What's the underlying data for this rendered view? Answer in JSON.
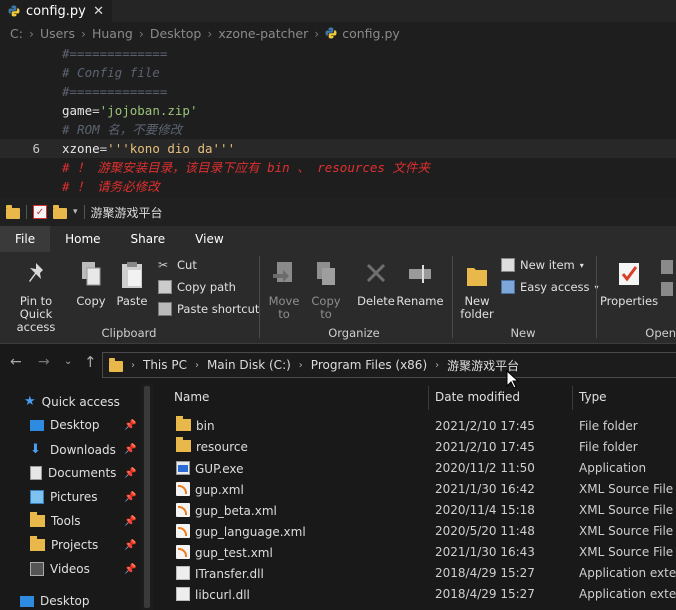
{
  "editor": {
    "tab_label": "config.py",
    "tab_close": "✕",
    "breadcrumb": [
      "C:",
      "Users",
      "Huang",
      "Desktop",
      "xzone-patcher",
      "config.py"
    ],
    "current_line_number": "6",
    "lines": {
      "l1": "#=============",
      "l2": "# Config file",
      "l3": "#=============",
      "l4_var": "game",
      "l4_op": "=",
      "l4_str": "'jojoban.zip'",
      "l5": "# ROM 名，不要修改",
      "l6_var": "xzone",
      "l6_op": "=",
      "l6_str": "'''kono dio da'''",
      "l7": "# ！ 游聚安装目录，该目录下应有 bin 、 resources 文件夹",
      "l8": "# ！ 请务必修改"
    }
  },
  "explorer": {
    "title": "游聚游戏平台",
    "menu": [
      "File",
      "Home",
      "Share",
      "View"
    ],
    "ribbon": {
      "clipboard": {
        "label": "Clipboard",
        "pin": "Pin to Quick access",
        "copy": "Copy",
        "paste": "Paste",
        "cut": "Cut",
        "copy_path": "Copy path",
        "paste_shortcut": "Paste shortcut"
      },
      "organize": {
        "label": "Organize",
        "move_to": "Move to",
        "copy_to": "Copy to",
        "delete": "Delete",
        "rename": "Rename"
      },
      "new": {
        "label": "New",
        "new_folder": "New folder",
        "new_item": "New item",
        "easy_access": "Easy access"
      },
      "open": {
        "label": "Open",
        "properties": "Properties"
      }
    },
    "address": {
      "segments": [
        "This PC",
        "Main Disk (C:)",
        "Program Files (x86)",
        "游聚游戏平台"
      ]
    },
    "nav_pane": {
      "quick_access": "Quick access",
      "items": [
        "Desktop",
        "Downloads",
        "Documents",
        "Pictures",
        "Tools",
        "Projects",
        "Videos"
      ],
      "bottom": "Desktop"
    },
    "columns": {
      "name": "Name",
      "date": "Date modified",
      "type": "Type"
    },
    "files": [
      {
        "name": "bin",
        "date": "2021/2/10 17:45",
        "type": "File folder",
        "icon": "folder-icon"
      },
      {
        "name": "resource",
        "date": "2021/2/10 17:45",
        "type": "File folder",
        "icon": "folder-icon"
      },
      {
        "name": "GUP.exe",
        "date": "2020/11/2 11:50",
        "type": "Application",
        "icon": "exe-icon"
      },
      {
        "name": "gup.xml",
        "date": "2021/1/30 16:42",
        "type": "XML Source File",
        "icon": "xml-icon"
      },
      {
        "name": "gup_beta.xml",
        "date": "2020/11/4 15:18",
        "type": "XML Source File",
        "icon": "xml-icon"
      },
      {
        "name": "gup_language.xml",
        "date": "2020/5/20 11:48",
        "type": "XML Source File",
        "icon": "xml-icon"
      },
      {
        "name": "gup_test.xml",
        "date": "2021/1/30 16:43",
        "type": "XML Source File",
        "icon": "xml-icon"
      },
      {
        "name": "ITransfer.dll",
        "date": "2018/4/29 15:27",
        "type": "Application exten...",
        "icon": "dll-icon"
      },
      {
        "name": "libcurl.dll",
        "date": "2018/4/29 15:27",
        "type": "Application exten...",
        "icon": "dll-icon"
      }
    ]
  }
}
